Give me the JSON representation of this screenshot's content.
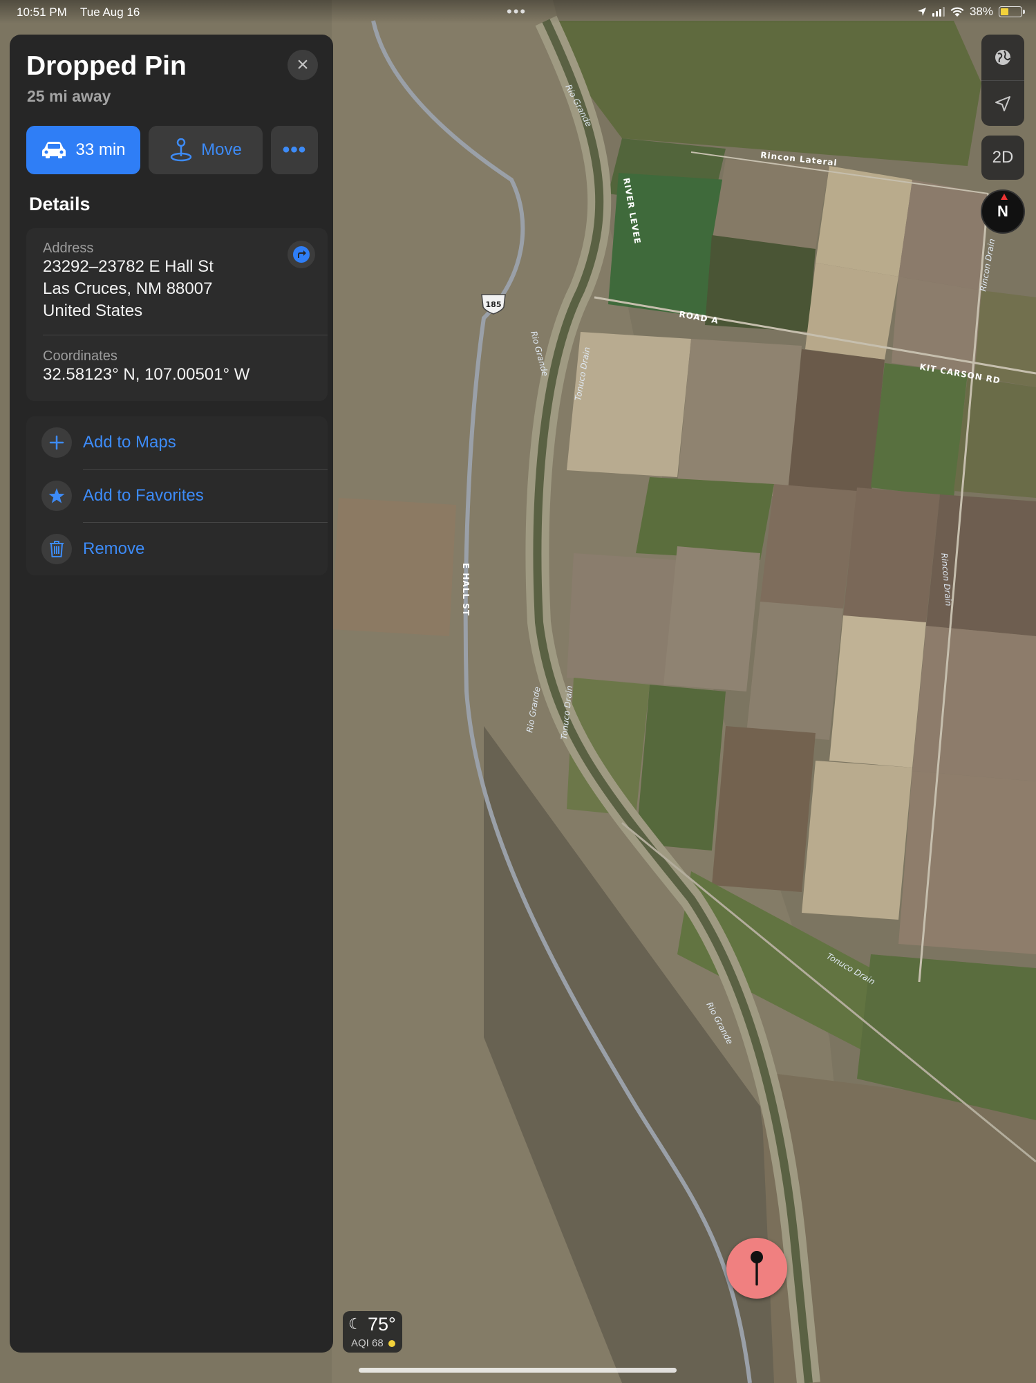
{
  "status_bar": {
    "time": "10:51 PM",
    "date": "Tue Aug 16",
    "battery": "38%",
    "battery_level": 0.38
  },
  "panel": {
    "title": "Dropped Pin",
    "subtitle": "25 mi away",
    "close_icon": "close-icon",
    "directions": {
      "icon": "car-icon",
      "label": "33 min"
    },
    "move": {
      "icon": "pin-move-icon",
      "label": "Move"
    },
    "more": {
      "icon": "ellipsis-icon"
    },
    "details_heading": "Details",
    "address": {
      "label": "Address",
      "line1": "23292–23782 E Hall St",
      "line2": "Las Cruces, NM  88007",
      "line3": "United States"
    },
    "coordinates": {
      "label": "Coordinates",
      "value": "32.58123° N, 107.00501° W"
    },
    "actions": [
      {
        "label": "Add to Maps",
        "icon": "plus-icon"
      },
      {
        "label": "Add to Favorites",
        "icon": "star-icon"
      },
      {
        "label": "Remove",
        "icon": "trash-icon"
      }
    ]
  },
  "map": {
    "road_labels": {
      "rincon_lateral": "Rincon Lateral",
      "river_levee": "RIVER LEVEE",
      "road_a": "ROAD A",
      "kit_carson": "KIT CARSON RD",
      "e_hall": "E HALL ST",
      "rincon_drain": "Rincon Drain",
      "tonuco_drain": "Tonuco Drain",
      "rio_grande": "Rio Grande",
      "route": "185"
    },
    "controls": {
      "view_mode": "2D",
      "compass": "N"
    },
    "weather": {
      "temperature": "75°",
      "aqi": "AQI 68"
    }
  },
  "colors": {
    "accent": "#2f7ef6",
    "link": "#3d8bf7",
    "pin": "#f08080"
  }
}
